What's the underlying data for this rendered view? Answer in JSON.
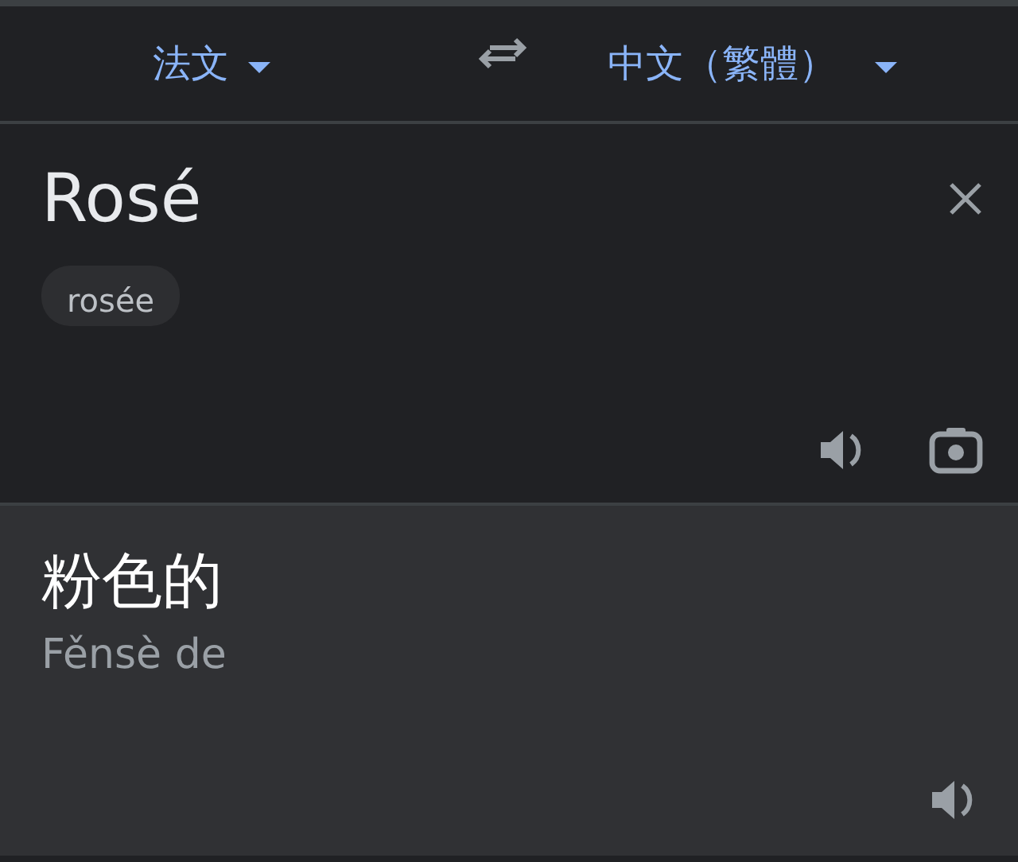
{
  "language_bar": {
    "source_language": "法文",
    "target_language": "中文（繁體）"
  },
  "input": {
    "text": "Rosé",
    "suggestion": "rosée"
  },
  "output": {
    "text": "粉色的",
    "romanization": "Fěnsè de"
  }
}
